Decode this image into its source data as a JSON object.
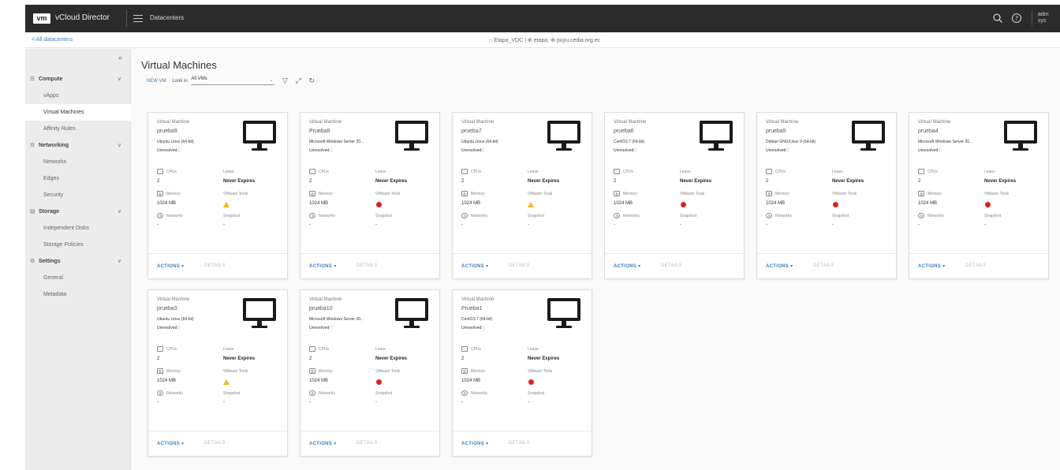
{
  "header": {
    "logo": "vm",
    "app_title": "vCloud Director",
    "section": "Datacenters",
    "user": "adm sys"
  },
  "subheader": {
    "back_link": "< All datacenters",
    "context": "⌂ Etapa_VDC  |  ⊕ etapa,  ⊕ puyu.cedia.org.ec"
  },
  "sidebar": {
    "collapse": "«",
    "groups": [
      {
        "label": "Compute",
        "icon": "cpu-icon",
        "items": [
          "vApps",
          "Virtual Machines",
          "Affinity Rules"
        ]
      },
      {
        "label": "Networking",
        "icon": "network-icon",
        "items": [
          "Networks",
          "Edges",
          "Security"
        ]
      },
      {
        "label": "Storage",
        "icon": "storage-icon",
        "items": [
          "Independent Disks",
          "Storage Policies"
        ]
      },
      {
        "label": "Settings",
        "icon": "gear-icon",
        "items": [
          "General",
          "Metadata"
        ]
      }
    ],
    "active_item": "Virtual Machines"
  },
  "main": {
    "title": "Virtual Machines",
    "new_vm": "NEW VM",
    "look_in_label": "Look in",
    "look_in_value": "All VMs"
  },
  "labels": {
    "type": "Virtual Machine",
    "cpus": "CPUs",
    "memory": "Memory",
    "networks": "Networks",
    "lease": "Lease",
    "vmware_tools": "VMware Tools",
    "snapshot": "Snapshot",
    "actions": "ACTIONS ▾",
    "details": "DETAILS",
    "resolved": "Unresolved",
    "resolved_badge": "ⓘ"
  },
  "cards": [
    {
      "name": "prueba9",
      "os": "Ubuntu Linux (64-bit)",
      "cpus": "2",
      "memory": "1024 MB",
      "networks": "-",
      "lease": "Never Expires",
      "tools": "warning",
      "snapshot": "-"
    },
    {
      "name": "Prueba8",
      "os": "Microsoft Windows Server 20...",
      "cpus": "2",
      "memory": "1024 MB",
      "networks": "-",
      "lease": "Never Expires",
      "tools": "error",
      "snapshot": "-"
    },
    {
      "name": "prueba7",
      "os": "Ubuntu Linux (64-bit)",
      "cpus": "2",
      "memory": "1024 MB",
      "networks": "-",
      "lease": "Never Expires",
      "tools": "warning",
      "snapshot": "-"
    },
    {
      "name": "prueba6",
      "os": "CentOS 7 (64-bit)",
      "cpus": "2",
      "memory": "1024 MB",
      "networks": "-",
      "lease": "Never Expires",
      "tools": "error",
      "snapshot": "-"
    },
    {
      "name": "prueba5",
      "os": "Debian GNU/Linux 9 (64-bit)",
      "cpus": "2",
      "memory": "1024 MB",
      "networks": "-",
      "lease": "Never Expires",
      "tools": "error",
      "snapshot": "-"
    },
    {
      "name": "prueba4",
      "os": "Microsoft Windows Server 20...",
      "cpus": "2",
      "memory": "1024 MB",
      "networks": "-",
      "lease": "Never Expires",
      "tools": "error",
      "snapshot": "-"
    },
    {
      "name": "prueba3",
      "os": "Ubuntu Linux (64-bit)",
      "cpus": "2",
      "memory": "1024 MB",
      "networks": "-",
      "lease": "Never Expires",
      "tools": "warning",
      "snapshot": "-"
    },
    {
      "name": "prueba10",
      "os": "Microsoft Windows Server 20...",
      "cpus": "2",
      "memory": "1024 MB",
      "networks": "-",
      "lease": "Never Expires",
      "tools": "error",
      "snapshot": "-"
    },
    {
      "name": "Prueba1",
      "os": "CentOS 7 (64-bit)",
      "cpus": "2",
      "memory": "1024 MB",
      "networks": "-",
      "lease": "Never Expires",
      "tools": "error",
      "snapshot": "-"
    }
  ]
}
